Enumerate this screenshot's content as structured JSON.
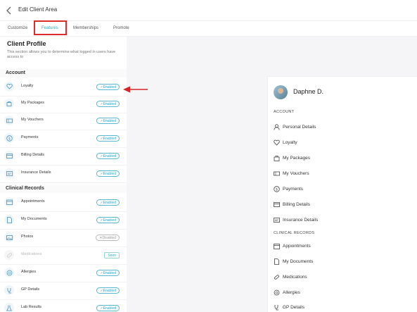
{
  "header": {
    "title": "Edit Client Area"
  },
  "tabs": [
    {
      "label": "Customize"
    },
    {
      "label": "Features"
    },
    {
      "label": "Memberships"
    },
    {
      "label": "Promote"
    }
  ],
  "client_profile": {
    "title": "Client Profile",
    "description": "This section allows you to determine what logged in users have access to"
  },
  "sections": {
    "account": "Account",
    "clinical": "Clinical Records"
  },
  "account_items": [
    {
      "label": "Loyalty",
      "status": "Enabled",
      "icon": "heart-icon"
    },
    {
      "label": "My Packages",
      "status": "Enabled",
      "icon": "bag-icon"
    },
    {
      "label": "My Vouchers",
      "status": "Enabled",
      "icon": "voucher-icon"
    },
    {
      "label": "Payments",
      "status": "Enabled",
      "icon": "dollar-icon"
    },
    {
      "label": "Billing Details",
      "status": "Enabled",
      "icon": "card-icon"
    },
    {
      "label": "Insurance Details",
      "status": "Enabled",
      "icon": "id-card-icon"
    }
  ],
  "clinical_items": [
    {
      "label": "Appointments",
      "status": "Enabled",
      "icon": "calendar-icon"
    },
    {
      "label": "My Documents",
      "status": "Enabled",
      "icon": "document-icon"
    },
    {
      "label": "Photos",
      "status": "Disabled",
      "icon": "photo-icon"
    },
    {
      "label": "Medications",
      "status": "Soon",
      "icon": "pill-icon"
    },
    {
      "label": "Allergies",
      "status": "Enabled",
      "icon": "allergy-icon"
    },
    {
      "label": "GP Details",
      "status": "Enabled",
      "icon": "stethoscope-icon"
    },
    {
      "label": "Lab Results",
      "status": "Enabled",
      "icon": "flask-icon"
    }
  ],
  "preview": {
    "name": "Daphne D.",
    "account_header": "ACCOUNT",
    "clinical_header": "CLINICAL RECORDS",
    "account_items": [
      "Personal Details",
      "Loyalty",
      "My Packages",
      "My Vouchers",
      "Payments",
      "Billing Details",
      "Insurance Details"
    ],
    "clinical_items": [
      "Appointments",
      "My Documents",
      "Medications",
      "Allergies",
      "GP Details"
    ]
  },
  "colors": {
    "accent": "#2aa8c8",
    "highlight": "#e02b2b",
    "grey_bg": "#f5f5f7"
  }
}
